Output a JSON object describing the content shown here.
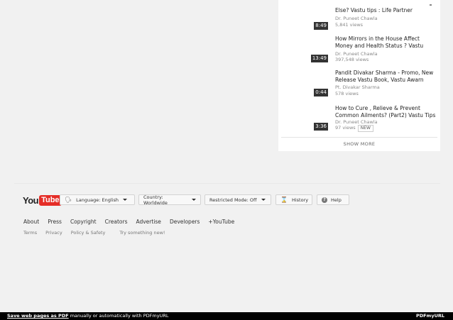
{
  "sidebar": {
    "videos": [
      {
        "title": "Else? Vastu tips : Life Partner",
        "channel": "Dr. Puneet Chawla",
        "views": "5,841 views",
        "duration": "8:49",
        "is_new": false
      },
      {
        "title": "How Mirrors in the House Affect Money and Health Status ? Vastu",
        "channel": "Dr. Puneet Chawla",
        "views": "397,548 views",
        "duration": "13:49",
        "is_new": false
      },
      {
        "title": "Pandit Divakar Sharma - Promo, New Release Vastu Book, Vastu Awarn",
        "channel": "Pt. Divakar Sharma",
        "views": "578 views",
        "duration": "0:44",
        "is_new": false
      },
      {
        "title": "How to Cure , Relieve & Prevent Common Ailments? (Part2) Vastu Tips",
        "channel": "Dr. Puneet Chawla",
        "views": "97 views",
        "duration": "3:36",
        "is_new": true,
        "badge": "NEW"
      }
    ],
    "show_more": "SHOW MORE"
  },
  "footer": {
    "logo": {
      "you": "You",
      "tube": "Tube"
    },
    "language_btn": "Language: English",
    "country_btn": "Country: Worldwide",
    "restricted_btn": "Restricted Mode: Off",
    "history_btn": "History",
    "help_btn": "Help",
    "links_primary": [
      "About",
      "Press",
      "Copyright",
      "Creators",
      "Advertise",
      "Developers",
      "+YouTube"
    ],
    "links_secondary": [
      "Terms",
      "Privacy",
      "Policy & Safety"
    ],
    "try_new": "Try something new!"
  },
  "pdf_banner": {
    "link": "Save web pages as PDF",
    "rest": " manually or automatically with PDFmyURL",
    "logo": "PDFmyURL"
  }
}
